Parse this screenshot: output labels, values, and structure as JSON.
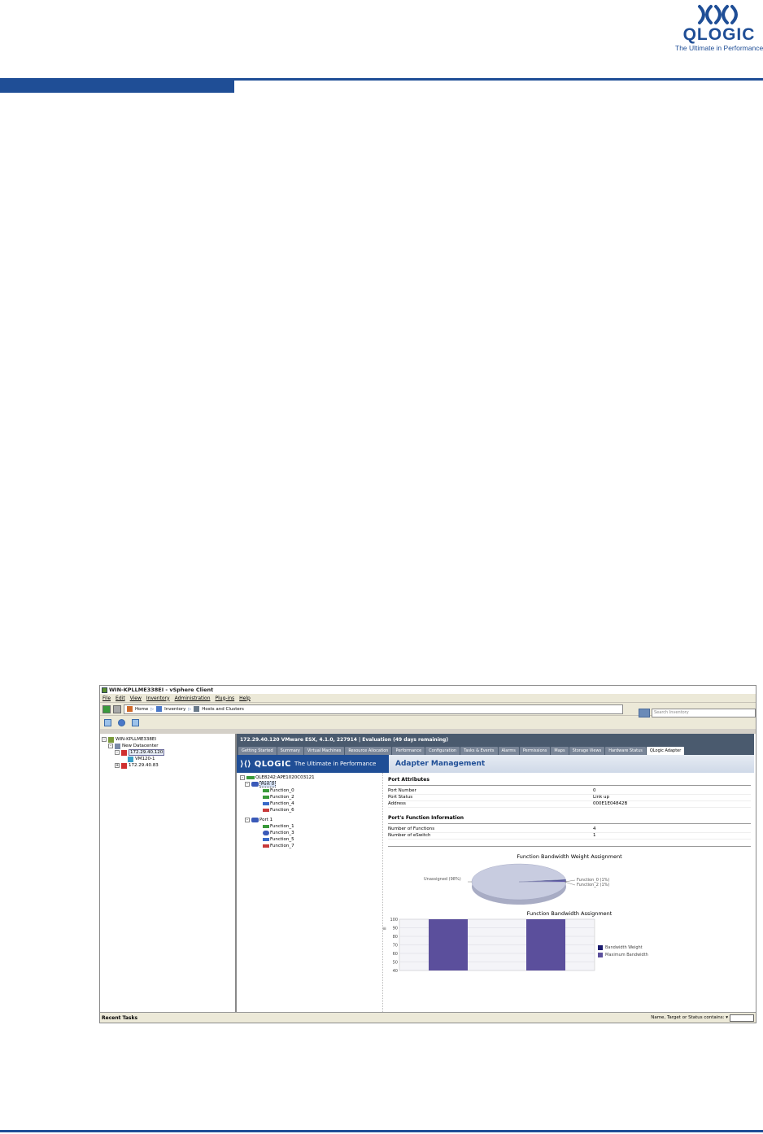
{
  "doc": {
    "logo_name": "QLOGIC",
    "logo_tagline": "The Ultimate in Performance"
  },
  "window": {
    "title": "WIN-KPLLME338EI - vSphere Client",
    "menu": [
      "File",
      "Edit",
      "View",
      "Inventory",
      "Administration",
      "Plug-ins",
      "Help"
    ],
    "breadcrumb": [
      "Home",
      "Inventory",
      "Hosts and Clusters"
    ],
    "search_placeholder": "Search Inventory"
  },
  "inventory_tree": [
    {
      "label": "WIN-KPLLME338EI",
      "toggle": "-",
      "icon": "vcenter-icon",
      "indent": 0
    },
    {
      "label": "New Datacenter",
      "toggle": "-",
      "icon": "datacenter-icon",
      "indent": 1
    },
    {
      "label": "172.29.40.120",
      "toggle": "-",
      "icon": "host-icon",
      "indent": 2,
      "selected": true
    },
    {
      "label": "VM120-1",
      "toggle": "",
      "icon": "vm-icon",
      "indent": 3
    },
    {
      "label": "172.29.40.83",
      "toggle": "+",
      "icon": "host-icon",
      "indent": 2
    }
  ],
  "host_header": "172.29.40.120 VMware ESX, 4.1.0, 227914 | Evaluation (49 days remaining)",
  "tabs": [
    "Getting Started",
    "Summary",
    "Virtual Machines",
    "Resource Allocation",
    "Performance",
    "Configuration",
    "Tasks & Events",
    "Alarms",
    "Permissions",
    "Maps",
    "Storage Views",
    "Hardware Status",
    "QLogic Adapter"
  ],
  "active_tab": "QLogic Adapter",
  "plugin": {
    "brand": "QLOGIC",
    "tagline": "The Ultimate in Performance",
    "title": "Adapter Management"
  },
  "adapter_tree": {
    "adapter": "QLE8242:APE1020C03121",
    "ports": [
      {
        "label": "Port 0",
        "selected": true,
        "functions": [
          {
            "label": "Function_0",
            "color": "#3a9a3a"
          },
          {
            "label": "Function_2",
            "color": "#3a9a3a"
          },
          {
            "label": "Function_4",
            "color": "#3a6ac8"
          },
          {
            "label": "Function_6",
            "color": "#c83a3a"
          }
        ]
      },
      {
        "label": "Port 1",
        "selected": false,
        "functions": [
          {
            "label": "Function_1",
            "color": "#3a9a3a"
          },
          {
            "label": "Function_3",
            "color": "#3a5ab8"
          },
          {
            "label": "Function_5",
            "color": "#3a6ac8"
          },
          {
            "label": "Function_7",
            "color": "#c83a3a"
          }
        ]
      }
    ]
  },
  "port_attributes": {
    "title": "Port Attributes",
    "rows": [
      {
        "key": "Port Number",
        "value": "0"
      },
      {
        "key": "Port Status",
        "value": "Link up"
      },
      {
        "key": "Address",
        "value": "000E1E04842B"
      }
    ]
  },
  "function_info": {
    "title": "Port's Function Information",
    "rows": [
      {
        "key": "Number of Functions",
        "value": "4"
      },
      {
        "key": "Number of eSwitch",
        "value": "1"
      }
    ]
  },
  "chart_data": [
    {
      "type": "pie",
      "title": "Function Bandwidth Weight Assignment",
      "slices": [
        {
          "label": "Unassigned (98%)",
          "value": 98,
          "color": "#c8cce0"
        },
        {
          "label": "Function_0 (1%)",
          "value": 1,
          "color": "#1a1a78"
        },
        {
          "label": "Function_2 (1%)",
          "value": 1,
          "color": "#5a4ea8"
        }
      ]
    },
    {
      "type": "bar",
      "title": "Function Bandwidth Assignment",
      "ylim": [
        40,
        100
      ],
      "yticks": [
        "100",
        "90",
        "80",
        "70",
        "60",
        "50",
        "40"
      ],
      "series": [
        {
          "name": "Bandwidth Weight",
          "color": "#1a1a6e",
          "values": [
            0,
            0
          ]
        },
        {
          "name": "Maximum Bandwidth",
          "color": "#5b4f9c",
          "values": [
            100,
            100
          ]
        }
      ]
    }
  ],
  "statusbar": {
    "left": "Recent Tasks",
    "filter_label": "Name, Target or Status contains: ▾"
  }
}
